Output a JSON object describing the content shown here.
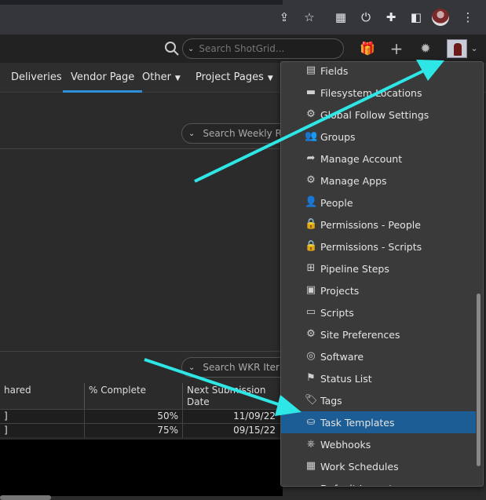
{
  "header": {
    "search_placeholder": "Search ShotGrid..."
  },
  "nav": {
    "items": [
      {
        "label": "Deliveries",
        "caret": false
      },
      {
        "label": "Vendor Page",
        "caret": false,
        "active": true
      },
      {
        "label": "Other",
        "caret": true
      },
      {
        "label": "Project Pages",
        "caret": true
      }
    ]
  },
  "content": {
    "search_weekly": "Search Weekly R",
    "search_wkr": "Search WKR Iter",
    "table": {
      "headers": [
        "hared",
        "% Complete",
        "Next Submission Date"
      ],
      "rows": [
        {
          "c0": "]",
          "pct": "50%",
          "date": "11/09/22"
        },
        {
          "c0": "]",
          "pct": "75%",
          "date": "09/15/22"
        }
      ]
    }
  },
  "menu": {
    "items": [
      {
        "label": "Fields",
        "icon": "fields-icon",
        "glyph": "▤"
      },
      {
        "label": "Filesystem Locations",
        "icon": "folder-icon",
        "glyph": "▬"
      },
      {
        "label": "Global Follow Settings",
        "icon": "gear-icon",
        "glyph": "⚙"
      },
      {
        "label": "Groups",
        "icon": "group-icon",
        "glyph": "👥"
      },
      {
        "label": "Manage Account",
        "icon": "share-arrow-icon",
        "glyph": "➦"
      },
      {
        "label": "Manage Apps",
        "icon": "gear-icon",
        "glyph": "⚙"
      },
      {
        "label": "People",
        "icon": "person-icon",
        "glyph": "👤"
      },
      {
        "label": "Permissions - People",
        "icon": "lock-icon",
        "glyph": "🔒"
      },
      {
        "label": "Permissions - Scripts",
        "icon": "lock-icon",
        "glyph": "🔒"
      },
      {
        "label": "Pipeline Steps",
        "icon": "pipeline-icon",
        "glyph": "⊞"
      },
      {
        "label": "Projects",
        "icon": "projects-icon",
        "glyph": "▣"
      },
      {
        "label": "Scripts",
        "icon": "scripts-icon",
        "glyph": "▭"
      },
      {
        "label": "Site Preferences",
        "icon": "gear-icon",
        "glyph": "⚙"
      },
      {
        "label": "Software",
        "icon": "software-icon",
        "glyph": "◎"
      },
      {
        "label": "Status List",
        "icon": "flag-icon",
        "glyph": "⚑"
      },
      {
        "label": "Tags",
        "icon": "tag-icon",
        "glyph": "🏷"
      },
      {
        "label": "Task Templates",
        "icon": "task-template-icon",
        "glyph": "⛀",
        "selected": true
      },
      {
        "label": "Webhooks",
        "icon": "webhook-icon",
        "glyph": "⎈"
      },
      {
        "label": "Work Schedules",
        "icon": "calendar-grid-icon",
        "glyph": "▦"
      },
      {
        "label": "Default Layouts",
        "icon": "layouts-icon",
        "glyph": ""
      }
    ]
  },
  "colors": {
    "accent": "#2d8fd5",
    "selected_bg": "#1d5d95",
    "annotation_arrow": "#2ee6e6"
  }
}
